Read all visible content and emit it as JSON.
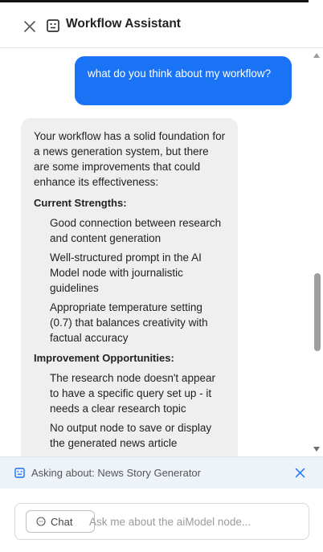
{
  "header": {
    "title": "Workflow Assistant",
    "close_icon": "close-icon",
    "assistant_icon": "robot-icon"
  },
  "messages": {
    "user": "what do you think about my workflow?",
    "ai": {
      "intro": "Your workflow has a solid foundation for a news generation system, but there are some improvements that could enhance its effectiveness:",
      "sections": [
        {
          "heading": "Current Strengths:",
          "items": [
            "Good connection between research and content generation",
            "Well-structured prompt in the AI Model node with journalistic guidelines",
            "Appropriate temperature setting (0.7) that balances creativity with factual accuracy"
          ]
        },
        {
          "heading": "Improvement Opportunities:",
          "items": [
            "The research node doesn't appear to have a specific query set up - it needs a clear research topic",
            "No output node to save or display the generated news article"
          ]
        }
      ]
    }
  },
  "context": {
    "label": "Asking about: News Story Generator"
  },
  "composer": {
    "mode_label": "Chat",
    "placeholder": "Ask me about the aiModel node..."
  },
  "colors": {
    "user_bubble": "#1a73f5",
    "ai_bubble": "#efefef",
    "context_bar": "#eef3fa",
    "accent": "#1a73f5"
  }
}
